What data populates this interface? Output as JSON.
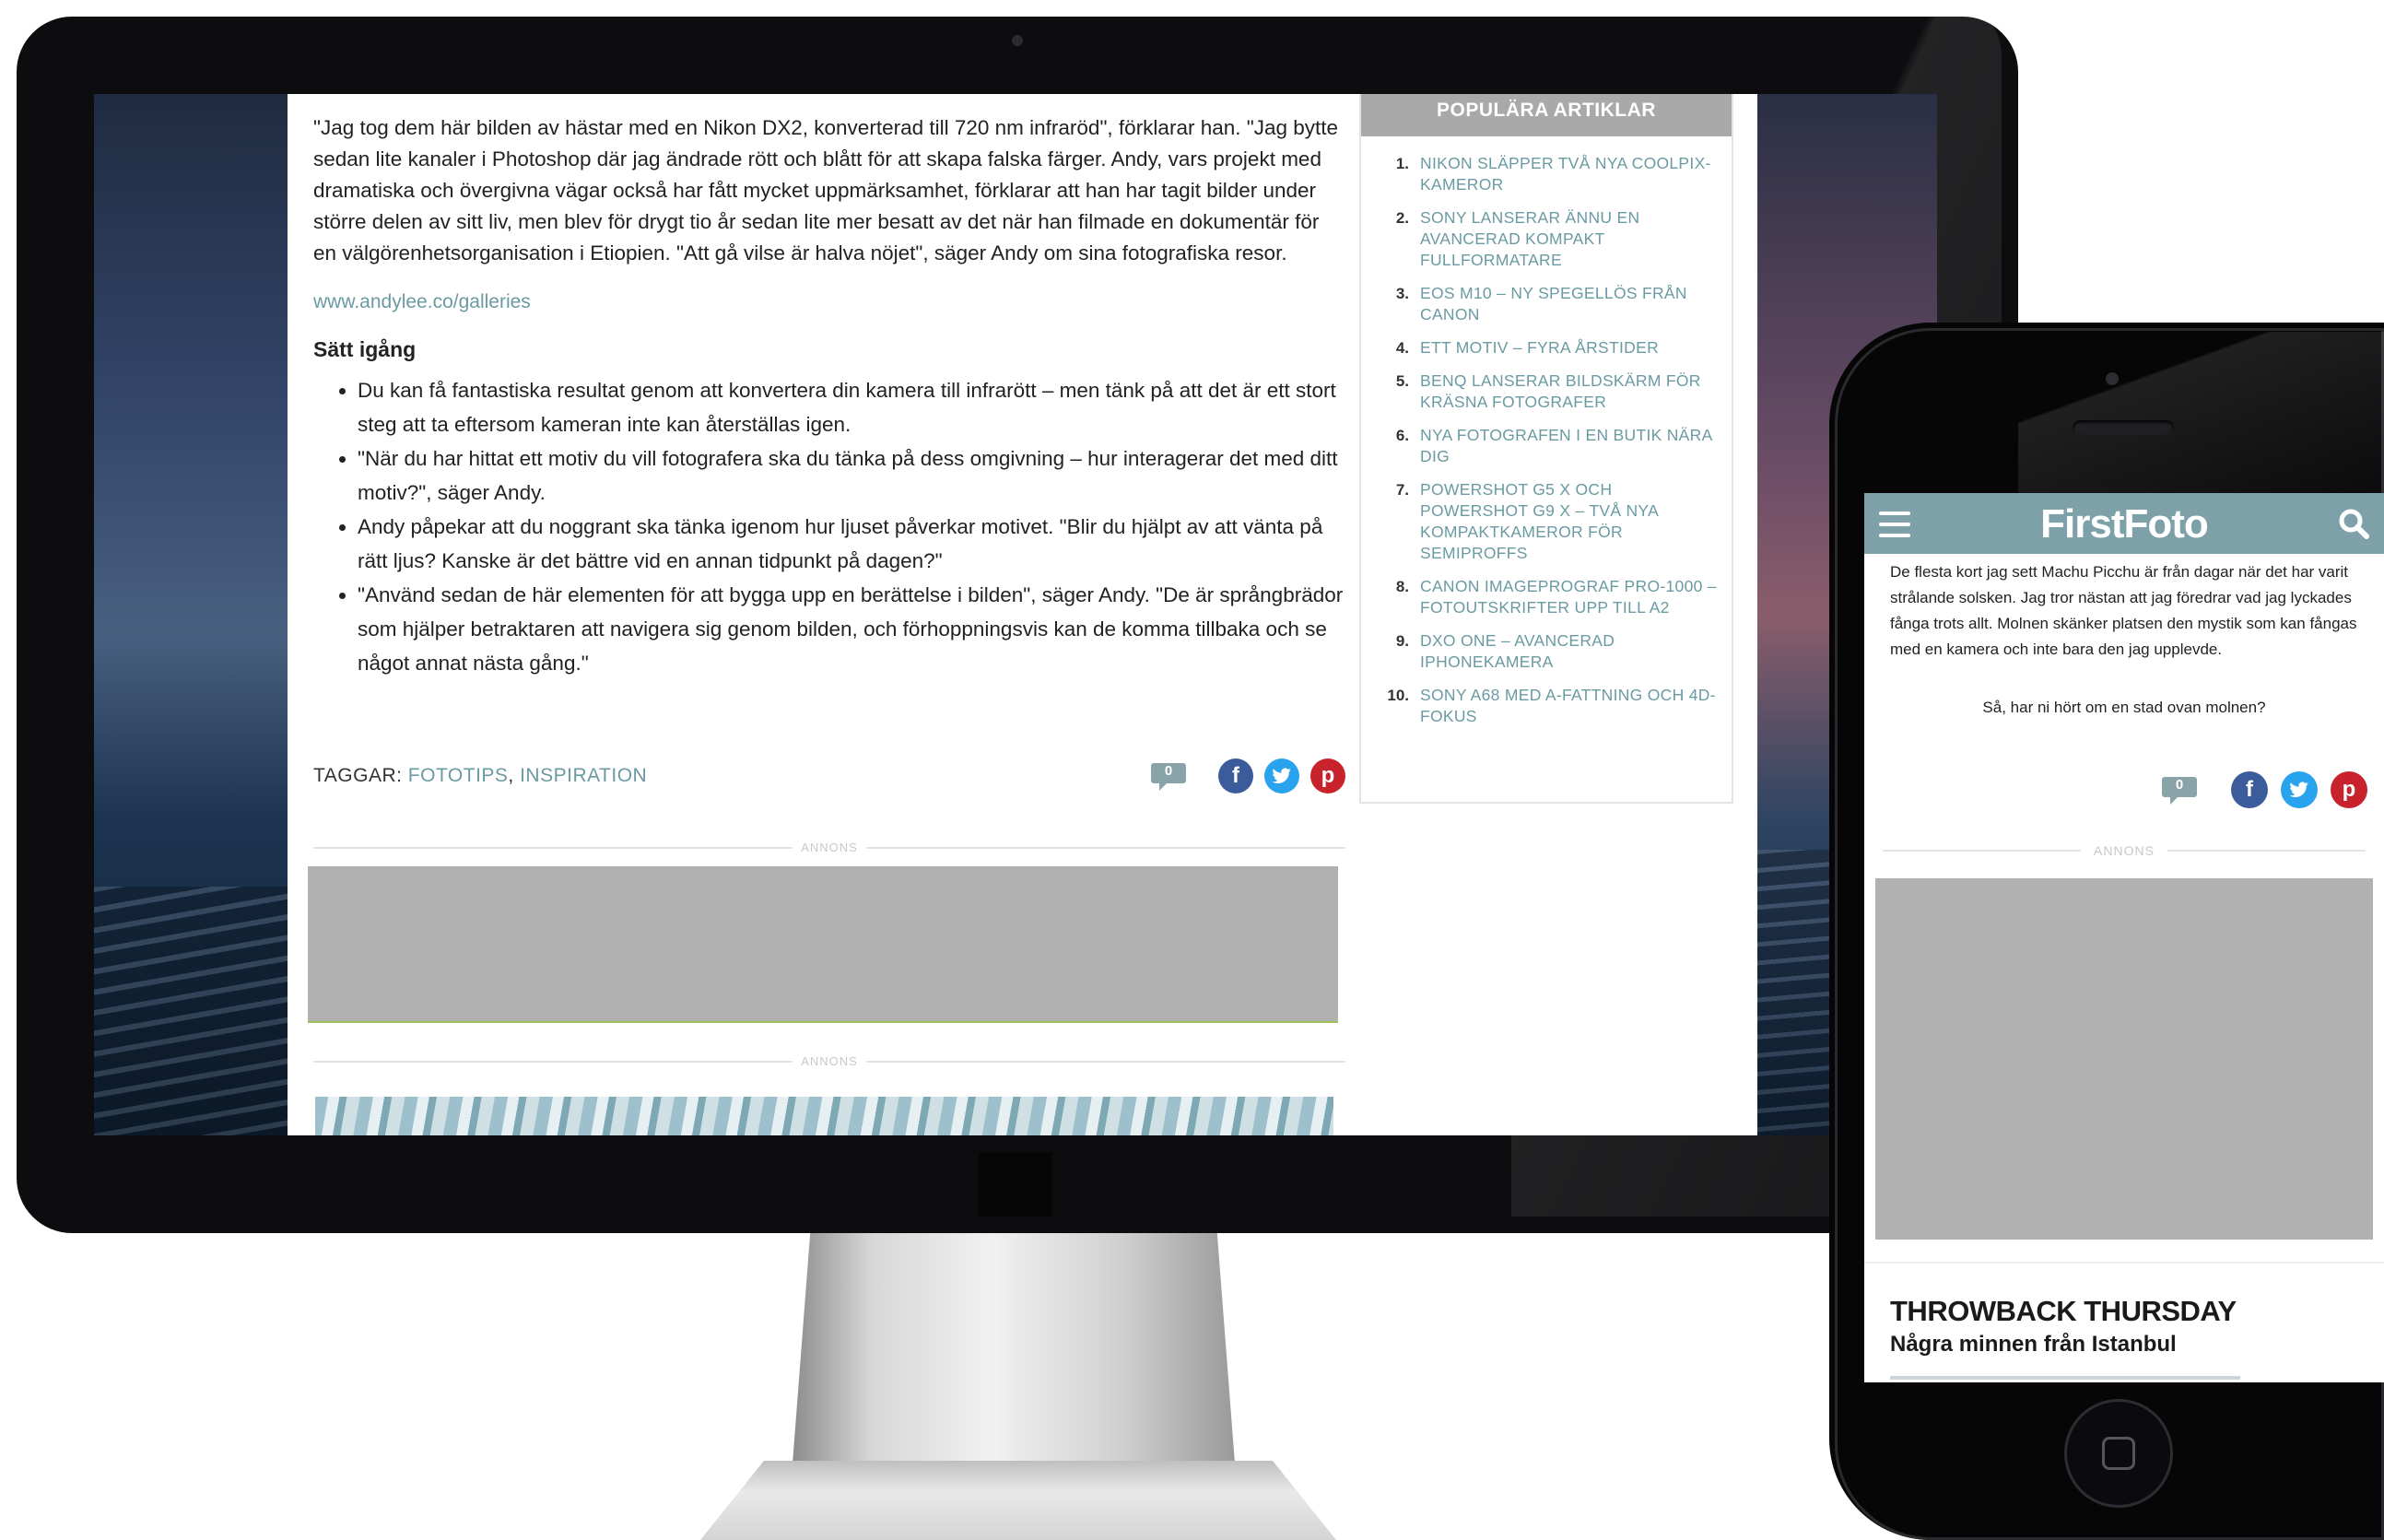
{
  "desktop": {
    "article": {
      "paragraph": "\"Jag tog dem här bilden av hästar med en Nikon DX2, konverterad till 720 nm infraröd\", förklarar han. \"Jag bytte sedan lite kanaler i Photoshop där jag ändrade rött och blått för att skapa falska färger. Andy, vars projekt med dramatiska och övergivna vägar också har fått mycket uppmärksamhet, förklarar att han har tagit bilder under större delen av sitt liv, men blev för drygt tio år sedan lite mer besatt av det när han filmade en dokumentär för en välgörenhetsorganisation i Etiopien. \"Att gå vilse är halva nöjet\", säger Andy om sina fotografiska resor.",
      "link": "www.andylee.co/galleries",
      "subhead": "Sätt igång",
      "bullets": [
        "Du kan få fantastiska resultat genom att konvertera din kamera till infrarött – men tänk på att det är ett stort steg att ta eftersom kameran inte kan återställas igen.",
        "\"När du har hittat ett motiv du vill fotografera ska du tänka på dess omgivning – hur interagerar det med ditt motiv?\", säger Andy.",
        "Andy påpekar att du noggrant ska tänka igenom hur ljuset påverkar motivet. \"Blir du hjälpt av att vänta på rätt ljus? Kanske är det bättre vid en annan tidpunkt på dagen?\"",
        "\"Använd sedan de här elementen för att bygga upp en berättelse i bilden\", säger Andy. \"De är språngbrädor som hjälper betraktaren att navigera sig genom bilden, och förhoppningsvis kan de komma tillbaka och se något annat nästa gång.\""
      ],
      "tags_label": "TAGGAR:",
      "tags": [
        "FOTOTIPS",
        "INSPIRATION"
      ],
      "tags_sep": ", ",
      "comment_count": "0",
      "ad_label": "ANNONS"
    },
    "sidebar": {
      "title": "POPULÄRA ARTIKLAR",
      "items": [
        {
          "num": "1.",
          "title": "NIKON SLÄPPER TVÅ NYA COOLPIX-KAMEROR"
        },
        {
          "num": "2.",
          "title": "SONY LANSERAR ÄNNU EN AVANCERAD KOMPAKT FULLFORMATARE"
        },
        {
          "num": "3.",
          "title": "EOS M10 – NY SPEGELLÖS FRÅN CANON"
        },
        {
          "num": "4.",
          "title": "ETT MOTIV – FYRA ÅRSTIDER"
        },
        {
          "num": "5.",
          "title": "BENQ LANSERAR BILDSKÄRM FÖR KRÄSNA FOTOGRAFER"
        },
        {
          "num": "6.",
          "title": "NYA FOTOGRAFEN I EN BUTIK NÄRA DIG"
        },
        {
          "num": "7.",
          "title": "POWERSHOT G5 X OCH POWERSHOT G9 X – TVÅ NYA KOMPAKTKAMEROR FÖR SEMIPROFFS"
        },
        {
          "num": "8.",
          "title": "CANON IMAGEPROGRAF PRO-1000 – FOTOUTSKRIFTER UPP TILL A2"
        },
        {
          "num": "9.",
          "title": "DXO ONE – AVANCERAD IPHONEKAMERA"
        },
        {
          "num": "10.",
          "title": "SONY A68 MED A-FATTNING OCH 4D-FOKUS"
        }
      ]
    }
  },
  "mobile": {
    "logo": "FirstFoto",
    "text": "De flesta kort jag sett Machu Picchu är från dagar när det har varit strålande solsken. Jag tror nästan att jag föredrar vad jag lyckades fånga trots allt. Molnen skänker platsen den mystik som kan fångas med en kamera och inte bara den jag upplevde.",
    "caption": "Så, har ni hört om en stad ovan molnen?",
    "comment_count": "0",
    "ad_label": "ANNONS",
    "next_title": "THROWBACK THURSDAY",
    "next_subtitle": "Några minnen från Istanbul"
  },
  "icons": {
    "facebook": "f",
    "twitter": "twitter-bird",
    "pinterest": "p",
    "comment": "speech-bubble",
    "menu": "hamburger",
    "search": "magnifier",
    "home": "rounded-square"
  },
  "colors": {
    "accent_link": "#6a9aa2",
    "mobile_header": "#7ea0a8",
    "facebook": "#3a5c9a",
    "twitter": "#2aa3ef",
    "pinterest": "#c8232c"
  }
}
